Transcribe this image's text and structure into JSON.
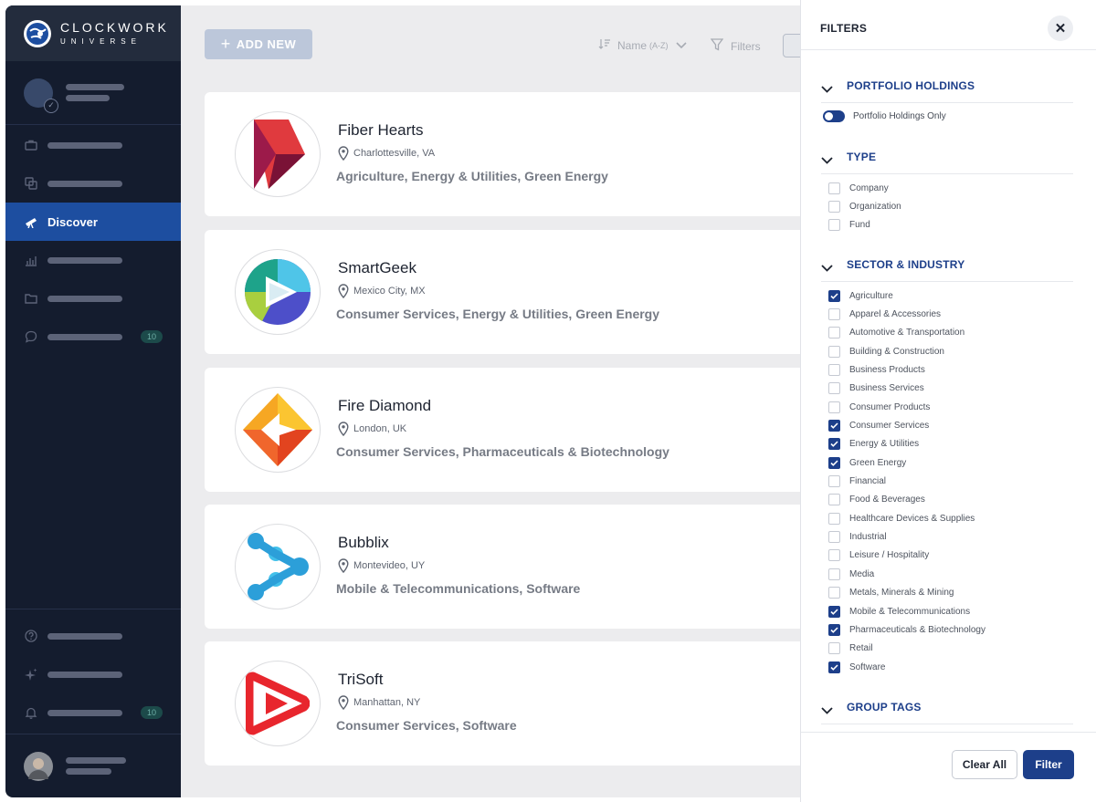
{
  "brand": {
    "name_line1": "CLOCKWORK",
    "name_line2": "UNIVERSE"
  },
  "sidebar": {
    "active_label": "Discover",
    "messages_badge": "10",
    "notifications_badge": "10"
  },
  "toolbar": {
    "add_label": "ADD NEW",
    "sort_label": "Name",
    "sort_sub": "(A-Z)",
    "filters_label": "Filters"
  },
  "companies": [
    {
      "name": "Fiber Hearts",
      "location": "Charlottesville, VA",
      "sectors": "Agriculture, Energy & Utilities, Green Energy"
    },
    {
      "name": "SmartGeek",
      "location": "Mexico City, MX",
      "sectors": "Consumer Services, Energy & Utilities, Green Energy"
    },
    {
      "name": "Fire Diamond",
      "location": "London, UK",
      "sectors": "Consumer Services, Pharmaceuticals & Biotechnology"
    },
    {
      "name": "Bubblix",
      "location": "Montevideo, UY",
      "sectors": "Mobile & Telecommunications, Software"
    },
    {
      "name": "TriSoft",
      "location": "Manhattan, NY",
      "sectors": "Consumer Services, Software"
    }
  ],
  "filters": {
    "title": "FILTERS",
    "portfolio": {
      "title": "PORTFOLIO HOLDINGS",
      "toggle_label": "Portfolio Holdings Only",
      "toggle_on": true
    },
    "type": {
      "title": "TYPE",
      "options": [
        {
          "label": "Company",
          "checked": false
        },
        {
          "label": "Organization",
          "checked": false
        },
        {
          "label": "Fund",
          "checked": false
        }
      ]
    },
    "sector": {
      "title": "SECTOR & INDUSTRY",
      "options": [
        {
          "label": "Agriculture",
          "checked": true
        },
        {
          "label": "Apparel & Accessories",
          "checked": false
        },
        {
          "label": "Automotive & Transportation",
          "checked": false
        },
        {
          "label": "Building & Construction",
          "checked": false
        },
        {
          "label": "Business Products",
          "checked": false
        },
        {
          "label": "Business Services",
          "checked": false
        },
        {
          "label": "Consumer Products",
          "checked": false
        },
        {
          "label": "Consumer Services",
          "checked": true
        },
        {
          "label": "Energy & Utilities",
          "checked": true
        },
        {
          "label": "Green Energy",
          "checked": true
        },
        {
          "label": "Financial",
          "checked": false
        },
        {
          "label": "Food & Beverages",
          "checked": false
        },
        {
          "label": "Healthcare Devices & Supplies",
          "checked": false
        },
        {
          "label": "Industrial",
          "checked": false
        },
        {
          "label": "Leisure / Hospitality",
          "checked": false
        },
        {
          "label": "Media",
          "checked": false
        },
        {
          "label": "Metals, Minerals & Mining",
          "checked": false
        },
        {
          "label": "Mobile & Telecommunications",
          "checked": true
        },
        {
          "label": "Pharmaceuticals & Biotechnology",
          "checked": true
        },
        {
          "label": "Retail",
          "checked": false
        },
        {
          "label": "Software",
          "checked": true
        }
      ]
    },
    "group_tags": {
      "title": "GROUP TAGS"
    },
    "clear_label": "Clear All",
    "apply_label": "Filter"
  },
  "colors": {
    "sidebar_bg": "#141c2e",
    "accent": "#1d4ea0",
    "primary_button": "#1d3f8a"
  }
}
